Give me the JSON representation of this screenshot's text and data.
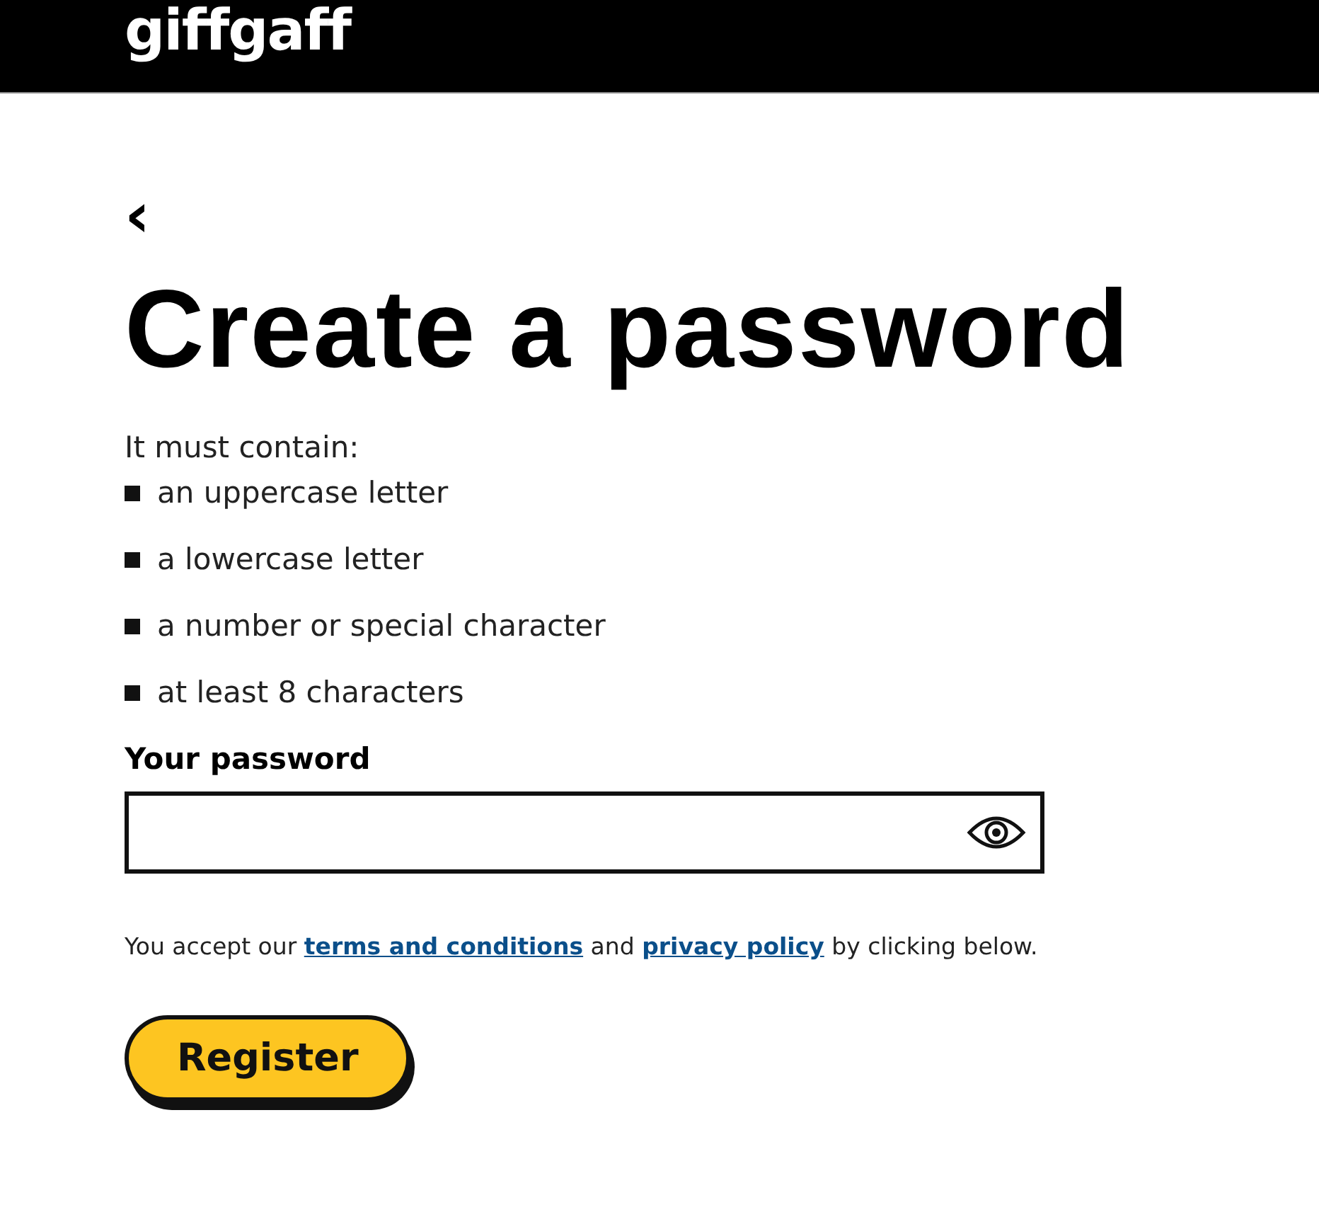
{
  "header": {
    "logo": "giffgaff"
  },
  "back": {
    "label": "‹"
  },
  "title": "Create a password",
  "requirements": {
    "intro": "It must contain:",
    "items": [
      "an uppercase letter",
      "a lowercase letter",
      "a number or special character",
      "at least 8 characters"
    ]
  },
  "password": {
    "label": "Your password"
  },
  "consent": {
    "parts": [
      {
        "kind": "text",
        "text": "You accept our "
      },
      {
        "kind": "link",
        "text": "terms and conditions"
      },
      {
        "kind": "text",
        "text": " and "
      },
      {
        "kind": "link",
        "text": "privacy policy"
      },
      {
        "kind": "text",
        "text": " by clicking below."
      }
    ]
  },
  "button": {
    "label": "Register"
  }
}
